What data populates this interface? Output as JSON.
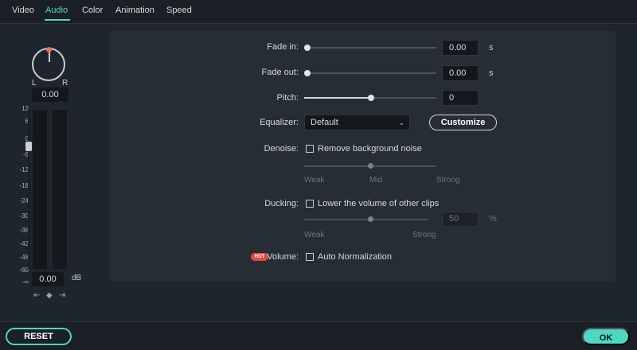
{
  "tabs": [
    {
      "label": "Video"
    },
    {
      "label": "Audio"
    },
    {
      "label": "Color"
    },
    {
      "label": "Animation"
    },
    {
      "label": "Speed"
    }
  ],
  "active_tab": "Audio",
  "accent_color": "#4fd7c4",
  "meter": {
    "pan_left": "L",
    "pan_right": "R",
    "pan_value": "0.00",
    "scale": [
      "12",
      "6",
      "0",
      "-6",
      "-12",
      "-18",
      "-24",
      "-30",
      "-36",
      "-42",
      "-48",
      "-60",
      "-∞"
    ],
    "volume_value": "0.00",
    "volume_unit": "dB",
    "nav_prev": "⇤",
    "nav_key": "◆",
    "nav_next": "⇥"
  },
  "fade_in": {
    "label": "Fade in:",
    "value": "0.00",
    "unit": "s"
  },
  "fade_out": {
    "label": "Fade out:",
    "value": "0.00",
    "unit": "s"
  },
  "pitch": {
    "label": "Pitch:",
    "value": "0"
  },
  "equalizer": {
    "label": "Equalizer:",
    "selected": "Default",
    "customize_label": "Customize"
  },
  "denoise": {
    "label": "Denoise:",
    "checkbox_label": "Remove background noise",
    "weak": "Weak",
    "mid": "Mid",
    "strong": "Strong"
  },
  "ducking": {
    "label": "Ducking:",
    "checkbox_label": "Lower the volume of other clips",
    "value": "50",
    "unit": "%",
    "weak": "Weak",
    "strong": "Strong"
  },
  "volume": {
    "badge": "HOT",
    "label": "Volume:",
    "checkbox_label": "Auto Normalization"
  },
  "buttons": {
    "reset": "RESET",
    "ok": "OK"
  }
}
